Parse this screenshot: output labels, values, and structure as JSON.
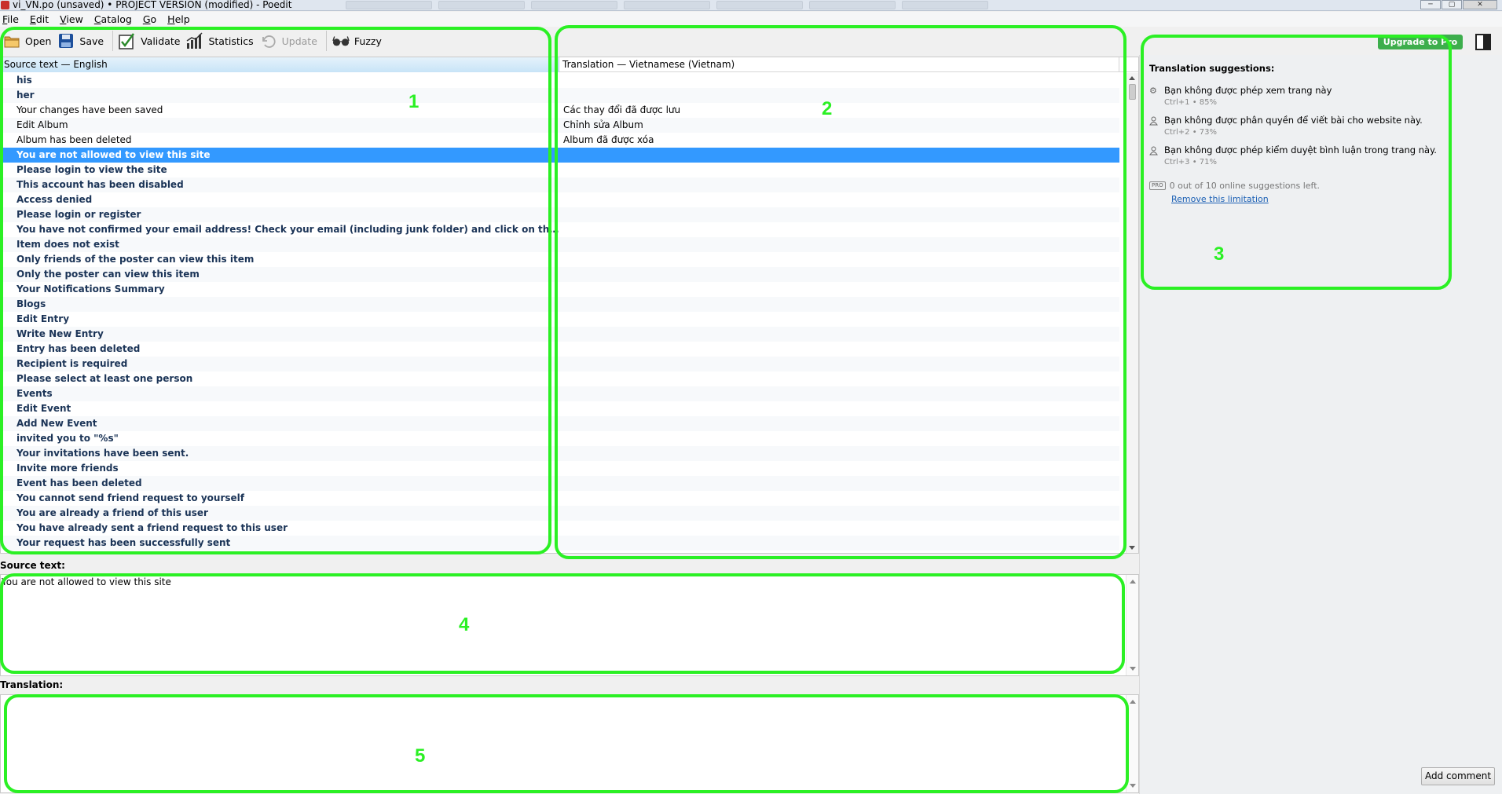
{
  "window": {
    "title": "vi_VN.po (unsaved) • PROJECT VERSION (modified) - Poedit",
    "controls": [
      "─",
      "▢",
      "✕"
    ]
  },
  "menu": [
    "File",
    "Edit",
    "View",
    "Catalog",
    "Go",
    "Help"
  ],
  "toolbar": {
    "open": "Open",
    "save": "Save",
    "validate": "Validate",
    "statistics": "Statistics",
    "update": "Update",
    "fuzzy": "Fuzzy",
    "upgrade": "Upgrade to Pro"
  },
  "list": {
    "source_header": "Source text — English",
    "translation_header": "Translation — Vietnamese (Vietnam)",
    "rows": [
      {
        "source": "his",
        "translation": "",
        "untranslated": true
      },
      {
        "source": "her",
        "translation": "",
        "untranslated": true
      },
      {
        "source": "Your changes have been saved",
        "translation": "Các thay đổi đã được lưu",
        "untranslated": false
      },
      {
        "source": "Edit Album",
        "translation": "Chỉnh sửa Album",
        "untranslated": false
      },
      {
        "source": "Album has been deleted",
        "translation": "Album đã được xóa",
        "untranslated": false
      },
      {
        "source": "You are not allowed to view this site",
        "translation": "",
        "untranslated": true,
        "selected": true
      },
      {
        "source": "Please login to view the site",
        "translation": "",
        "untranslated": true
      },
      {
        "source": "This account has been disabled",
        "translation": "",
        "untranslated": true
      },
      {
        "source": "Access denied",
        "translation": "",
        "untranslated": true
      },
      {
        "source": "Please login or register",
        "translation": "",
        "untranslated": true
      },
      {
        "source": "You have not confirmed your email address! Check your email (including junk folder) and click on the validation link to vali...",
        "translation": "",
        "untranslated": true
      },
      {
        "source": "Item does not exist",
        "translation": "",
        "untranslated": true
      },
      {
        "source": "Only friends of the poster can view this item",
        "translation": "",
        "untranslated": true
      },
      {
        "source": "Only the poster can view this item",
        "translation": "",
        "untranslated": true
      },
      {
        "source": "Your Notifications Summary",
        "translation": "",
        "untranslated": true
      },
      {
        "source": "Blogs",
        "translation": "",
        "untranslated": true
      },
      {
        "source": "Edit Entry",
        "translation": "",
        "untranslated": true
      },
      {
        "source": "Write New Entry",
        "translation": "",
        "untranslated": true
      },
      {
        "source": "Entry has been deleted",
        "translation": "",
        "untranslated": true
      },
      {
        "source": "Recipient is required",
        "translation": "",
        "untranslated": true
      },
      {
        "source": "Please select at least one person",
        "translation": "",
        "untranslated": true
      },
      {
        "source": "Events",
        "translation": "",
        "untranslated": true
      },
      {
        "source": "Edit Event",
        "translation": "",
        "untranslated": true
      },
      {
        "source": "Add New Event",
        "translation": "",
        "untranslated": true
      },
      {
        "source": "invited you to \"%s\"",
        "translation": "",
        "untranslated": true
      },
      {
        "source": "Your invitations have been sent.",
        "translation": "",
        "untranslated": true
      },
      {
        "source": "Invite more friends",
        "translation": "",
        "untranslated": true
      },
      {
        "source": "Event has been deleted",
        "translation": "",
        "untranslated": true
      },
      {
        "source": "You cannot send friend request to yourself",
        "translation": "",
        "untranslated": true
      },
      {
        "source": "You are already a friend of this user",
        "translation": "",
        "untranslated": true
      },
      {
        "source": "You have already sent a friend request to this user",
        "translation": "",
        "untranslated": true
      },
      {
        "source": "Your request has been successfully sent",
        "translation": "",
        "untranslated": true
      }
    ]
  },
  "editor": {
    "source_label": "Source text:",
    "source_value": "You are not allowed to view this site",
    "translation_label": "Translation:",
    "translation_value": ""
  },
  "sidebar": {
    "title": "Translation suggestions:",
    "suggestions": [
      {
        "text": "Bạn không được phép xem trang này",
        "meta": "Ctrl+1 • 85%",
        "icon": "gear-icon"
      },
      {
        "text": "Bạn không được phân quyền để viết bài cho website này.",
        "meta": "Ctrl+2 • 73%",
        "icon": "person-icon"
      },
      {
        "text": "Bạn không được phép kiểm duyệt bình luận trong trang này.",
        "meta": "Ctrl+3 • 71%",
        "icon": "person-icon"
      }
    ],
    "pro_badge": "PRO",
    "pro_text": "0 out of 10 online suggestions left.",
    "remove_limit": "Remove this limitation",
    "add_comment": "Add comment"
  },
  "annotations": [
    "1",
    "2",
    "3",
    "4",
    "5"
  ],
  "colors": {
    "annotation": "#2bf024",
    "selection": "#3399ff",
    "untranslated_text": "#1b3457",
    "upgrade": "#3dae4c",
    "link": "#1a5fb4"
  }
}
